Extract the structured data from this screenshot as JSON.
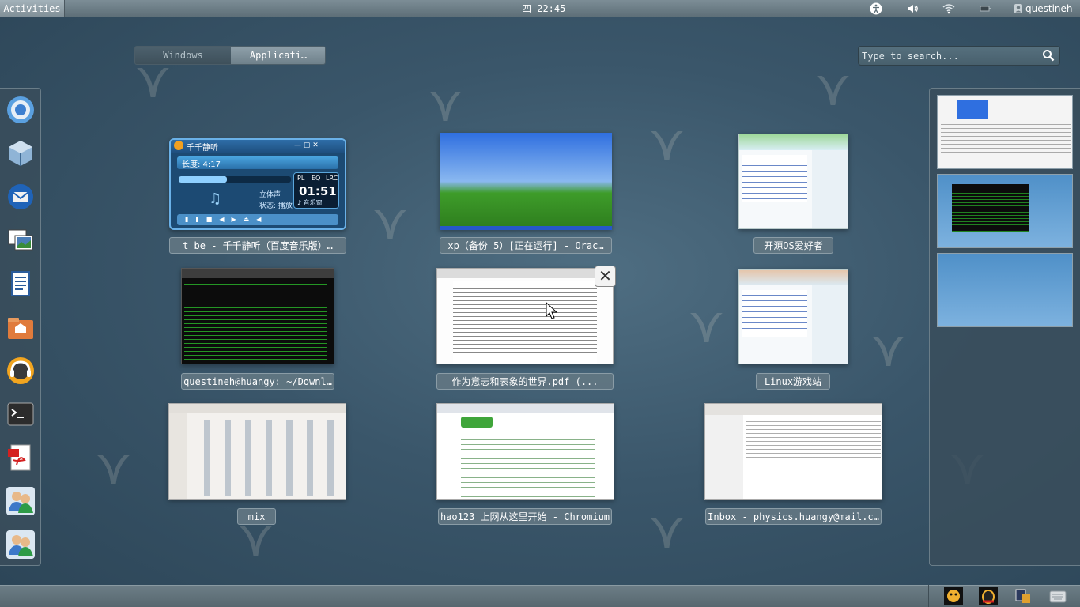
{
  "topbar": {
    "activities_label": "Activities",
    "clock": "四 22:45",
    "username": "questineh",
    "status_icons": [
      "accessibility-icon",
      "volume-icon",
      "network-wireless-icon",
      "battery-icon",
      "user-icon"
    ]
  },
  "overview": {
    "tabs": [
      {
        "label": "Windows",
        "active": false
      },
      {
        "label": "Applicati…",
        "active": true
      }
    ],
    "search_placeholder": "Type to search..."
  },
  "dash": {
    "apps": [
      "chromium-icon",
      "virtualbox-icon",
      "thunderbird-icon",
      "image-viewer-icon",
      "text-editor-icon",
      "home-folder-icon",
      "music-player-icon",
      "terminal-icon",
      "pdf-reader-icon",
      "contacts-icon",
      "empathy-icon"
    ]
  },
  "windows": [
    {
      "caption": "t be - 千千静听（百度音乐版）…"
    },
    {
      "caption": "xp（备份 5）[正在运行] - Orac…"
    },
    {
      "caption": "开源OS爱好者"
    },
    {
      "caption": "questineh@huangy: ~/Downl…"
    },
    {
      "caption": "作为意志和表象的世界.pdf (..."
    },
    {
      "caption": "Linux游戏站"
    },
    {
      "caption": "mix"
    },
    {
      "caption": "hao123_上网从这里开始 - Chromium"
    },
    {
      "caption": "Inbox - physics.huangy@mail.c…"
    }
  ],
  "player": {
    "title": "千千静听",
    "length": "长度: 4:17",
    "time": "01:51",
    "status_left": "立体声",
    "status_right": "状态: 播放",
    "tabs": [
      "PL",
      "EQ",
      "LRC"
    ],
    "music_window": "♪ 音乐窗"
  },
  "bottombar": {
    "tray_icons": [
      "qq-penguin-icon",
      "qq-chat-icon",
      "notification-icon",
      "keyboard-icon"
    ]
  },
  "colors": {
    "accent": "#8fa0aa",
    "panel": "#5e6f78"
  }
}
